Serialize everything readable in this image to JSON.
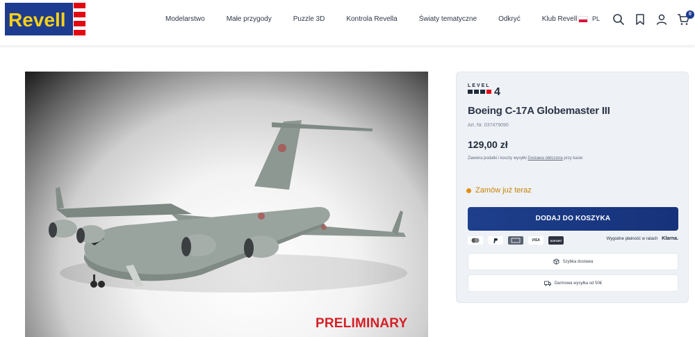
{
  "brand": {
    "logo_text": "Revell",
    "accent": "#1d3b8f",
    "logo_red": "#e30613",
    "logo_yellow": "#f7d117"
  },
  "nav": {
    "items": [
      "Modelarstwo",
      "Małe przygody",
      "Puzzle 3D",
      "Kontrola Revella",
      "Światy tematyczne",
      "Odkryć",
      "Klub Revell"
    ]
  },
  "header": {
    "language": "PL",
    "icons": [
      "search-icon",
      "bookmark-icon",
      "user-icon",
      "cart-icon"
    ],
    "cart_count": "0"
  },
  "product": {
    "image_overlay": "PRELIMINARY",
    "level_label": "LEVEL",
    "level_value": "4",
    "title": "Boeing C-17A Globemaster III",
    "art_nr": "Art. Nr. 037479090",
    "price": "129,00 zł",
    "tax_note_prefix": "Zawiera podatki i koszty wysyłki",
    "tax_note_link": "Dostawa obliczona",
    "tax_note_suffix": "przy kasie",
    "availability": "Zamów już teraz",
    "add_to_cart": "DODAJ DO KOSZYKA",
    "payment_methods": [
      "Apple Pay",
      "PayPal",
      "American Express",
      "VISA",
      "SOFORT"
    ],
    "payment_note": "Wygodne płatność w ratach",
    "payment_provider": "Klarna.",
    "features": [
      "Szybka dostawa",
      "Darmowa wysyłka od 50€"
    ]
  },
  "colors": {
    "availability": "#e28f0c",
    "preliminary": "#d51f26"
  }
}
